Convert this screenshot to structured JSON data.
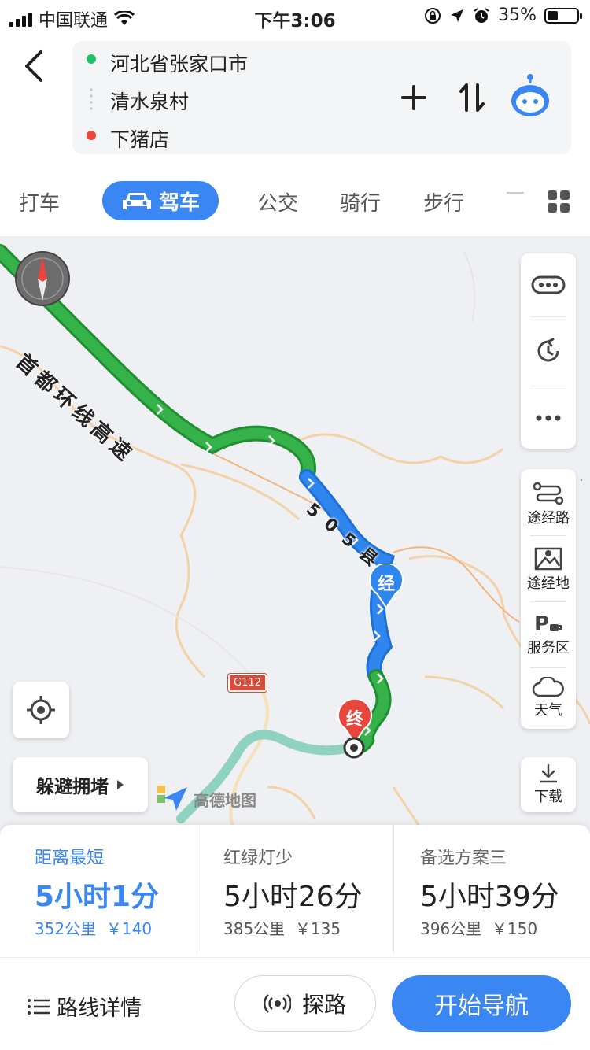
{
  "status_bar": {
    "carrier": "中国联通",
    "time": "下午3:06",
    "battery": "35%"
  },
  "route": {
    "origin": "河北省张家口市",
    "waypoint": "清水泉村",
    "destination": "下猪店",
    "origin_color": "#22c06b",
    "destination_color": "#f0453a"
  },
  "modes": {
    "taxi": "打车",
    "drive": "驾车",
    "bus": "公交",
    "cycling": "骑行",
    "walk": "步行"
  },
  "map": {
    "road_label_1": "首都环线高速",
    "road_label_2": "505县",
    "road_sign": "G112",
    "waypoint_marker": "经",
    "end_marker": "终",
    "watermark": "高德地图",
    "avoid_congestion": "躲避拥堵",
    "controls": {
      "via_route": "途经路",
      "via_place": "途经地",
      "service_area": "服务区",
      "weather": "天气",
      "download": "下载"
    },
    "colors": {
      "smooth": "#2eaa3f",
      "route_blue": "#2f86ee",
      "alt_route": "#8fd2bf"
    }
  },
  "routes": [
    {
      "title": "距离最短",
      "time": "5小时1分",
      "distance": "352公里",
      "fee": "￥140"
    },
    {
      "title": "红绿灯少",
      "time": "5小时26分",
      "distance": "385公里",
      "fee": "￥135"
    },
    {
      "title": "备选方案三",
      "time": "5小时39分",
      "distance": "396公里",
      "fee": "￥150"
    }
  ],
  "bottom": {
    "details": "路线详情",
    "explore": "探路",
    "start_navigation": "开始导航"
  },
  "accent_color": "#3a86f3"
}
